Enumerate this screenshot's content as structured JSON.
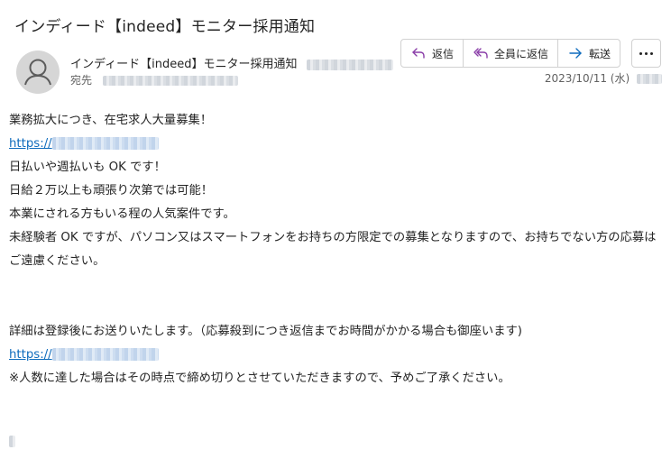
{
  "email": {
    "subject": "インディード【indeed】モニター採用通知",
    "sender_name": "インディード【indeed】モニター採用通知",
    "recipient_label": "宛先",
    "date": "2023/10/11 (水)",
    "avatar_icon": "person-icon"
  },
  "actions": {
    "reply": {
      "label": "返信",
      "icon": "reply-icon"
    },
    "reply_all": {
      "label": "全員に返信",
      "icon": "reply-all-icon"
    },
    "forward": {
      "label": "転送",
      "icon": "forward-icon"
    },
    "more_icon": "more-options-icon"
  },
  "body": {
    "line1": "業務拡大につき、在宅求人大量募集！",
    "link1_prefix": "https://",
    "line2": "日払いや週払いも OK です！",
    "line3": "日給２万以上も頑張り次第では可能！",
    "line4": "本業にされる方もいる程の人気案件です。",
    "line5": "未経験者 OK ですが、パソコン又はスマートフォンをお持ちの方限定での募集となりますので、お持ちでない方の応募はご遠慮ください。",
    "line6": "詳細は登録後にお送りいたします。（応募殺到につき返信までお時間がかかる場合も御座います)",
    "link2_prefix": "https://",
    "line7": "※人数に達した場合はその時点で締め切りとさせていただきますので、予めご了承ください。"
  },
  "colors": {
    "link": "#0f6cbd",
    "text": "#242424",
    "muted": "#616161",
    "accent_icon": "#8a3ea8",
    "forward_icon": "#0f6cbd"
  }
}
